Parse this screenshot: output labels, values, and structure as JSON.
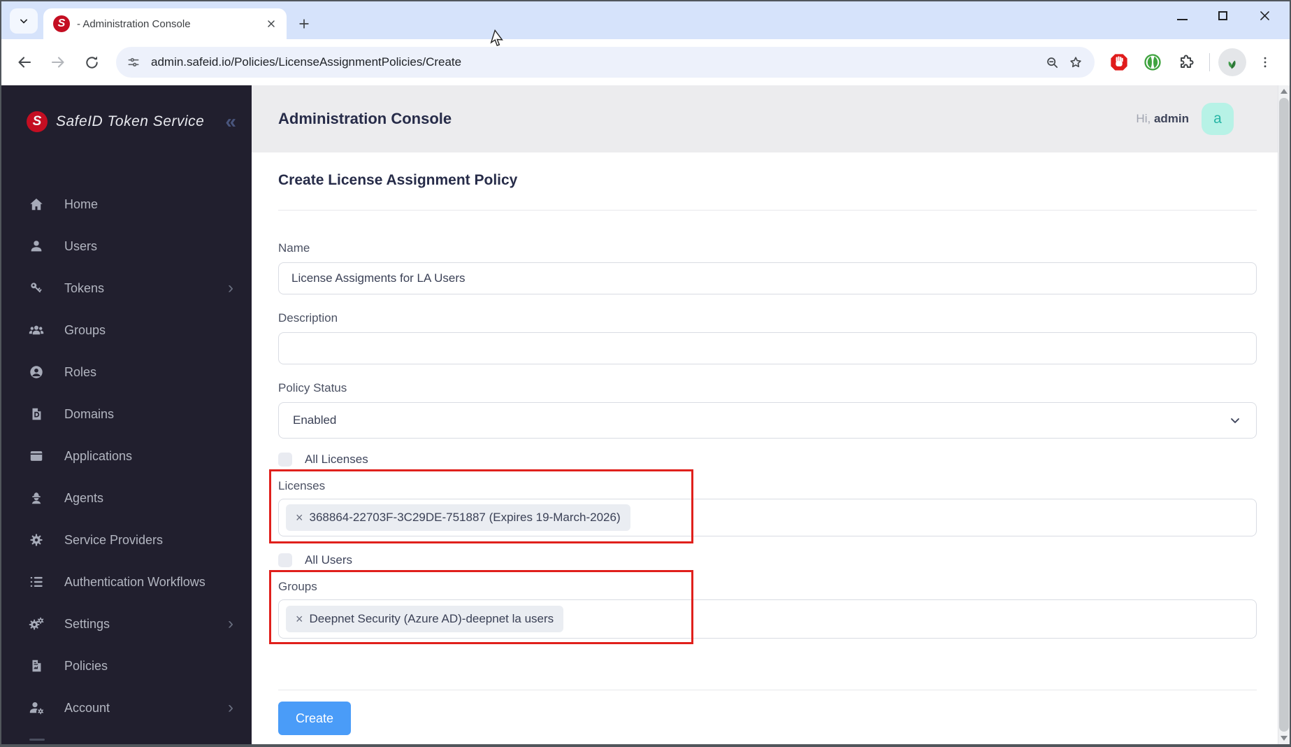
{
  "browser": {
    "tab": {
      "title": "- Administration Console",
      "favicon_letter": "S"
    },
    "url": "admin.safeid.io/Policies/LicenseAssignmentPolicies/Create",
    "window_controls": {
      "minimize_glyph": "–",
      "close_glyph": "×"
    }
  },
  "sidebar": {
    "brand": "SafeID Token Service",
    "brand_letter": "S",
    "collapse_glyph": "«",
    "expand_glyph": "›",
    "items": [
      {
        "label": "Home"
      },
      {
        "label": "Users"
      },
      {
        "label": "Tokens",
        "has_submenu": true
      },
      {
        "label": "Groups"
      },
      {
        "label": "Roles"
      },
      {
        "label": "Domains"
      },
      {
        "label": "Applications"
      },
      {
        "label": "Agents"
      },
      {
        "label": "Service Providers"
      },
      {
        "label": "Authentication Workflows"
      },
      {
        "label": "Settings",
        "has_submenu": true
      },
      {
        "label": "Policies"
      },
      {
        "label": "Account",
        "has_submenu": true
      }
    ]
  },
  "header": {
    "title": "Administration Console",
    "greeting_prefix": "Hi,",
    "username": "admin",
    "avatar_letter": "a"
  },
  "page": {
    "heading": "Create License Assignment Policy",
    "form": {
      "name_label": "Name",
      "name_value": "License Assigments for LA Users",
      "description_label": "Description",
      "description_value": "",
      "policy_status_label": "Policy Status",
      "policy_status_value": "Enabled",
      "all_licenses_label": "All Licenses",
      "licenses_label": "Licenses",
      "license_chip": "368864-22703F-3C29DE-751887 (Expires 19-March-2026)",
      "all_users_label": "All Users",
      "groups_label": "Groups",
      "group_chip": "Deepnet Security (Azure AD)-deepnet la users",
      "chip_remove_glyph": "×",
      "create_button": "Create"
    }
  },
  "colors": {
    "accent_blue": "#4a9cf8",
    "annotation_red": "#e0201c",
    "sidebar_bg": "#211f2e",
    "brand_red": "#c40e22",
    "avatar_bg": "#b7f2e6",
    "avatar_text": "#27b5a5",
    "titlebar": "#d6e3fb"
  }
}
